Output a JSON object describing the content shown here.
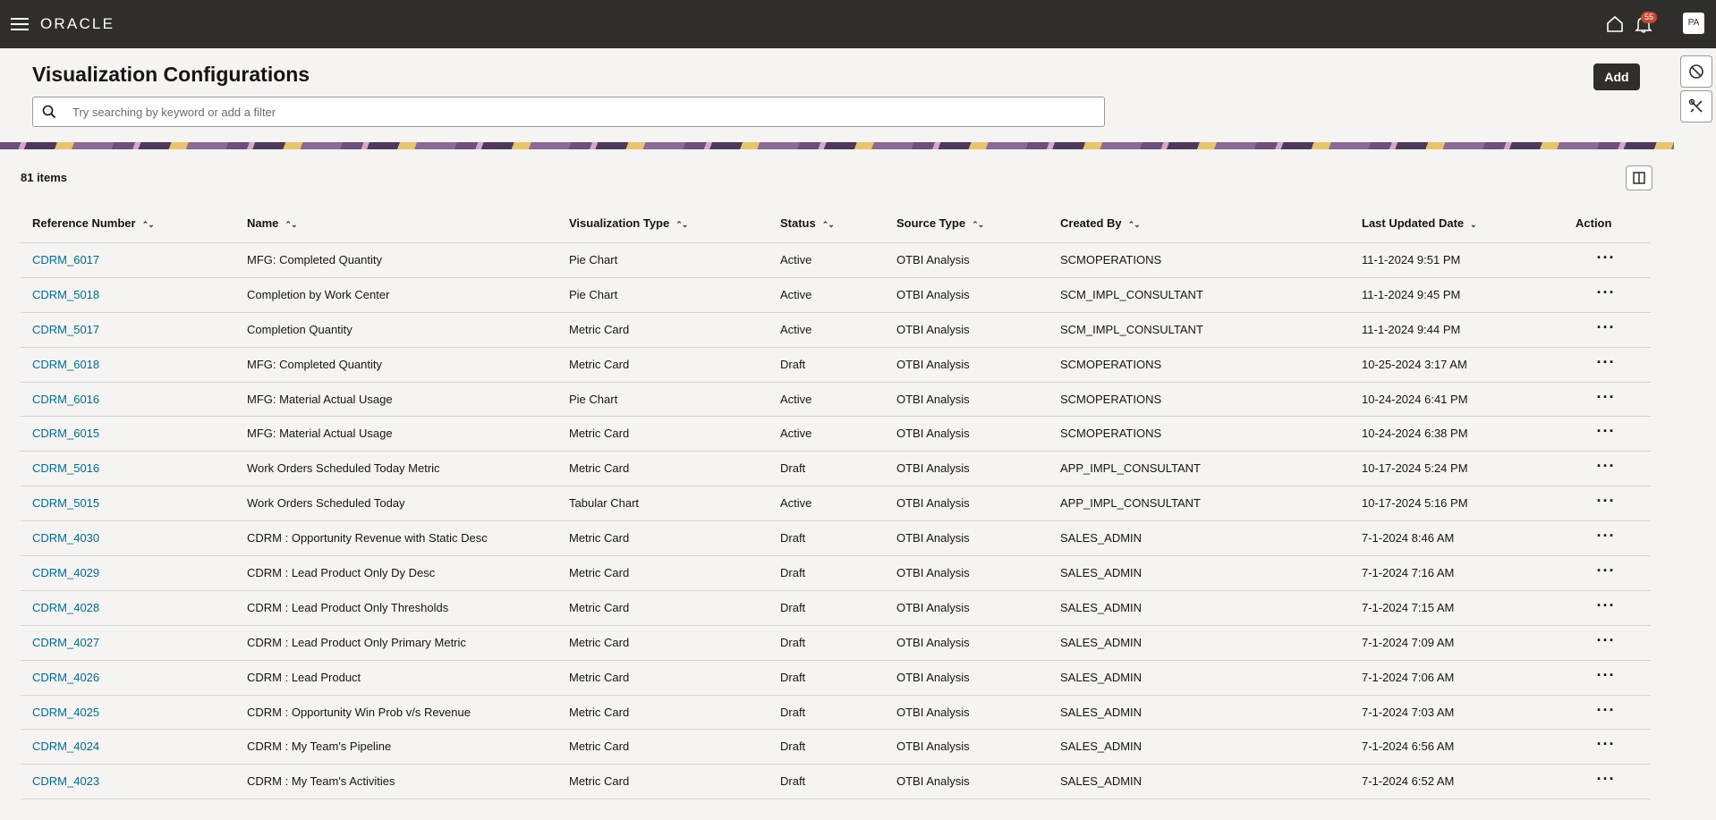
{
  "header": {
    "logo_text": "ORACLE",
    "notification_count": "55",
    "avatar_initials": "PA"
  },
  "page": {
    "title": "Visualization Configurations",
    "add_label": "Add",
    "search_placeholder": "Try searching by keyword or add a filter",
    "items_count": "81 items"
  },
  "table": {
    "columns": [
      {
        "label": "Reference Number",
        "sort": "both"
      },
      {
        "label": "Name",
        "sort": "both"
      },
      {
        "label": "Visualization Type",
        "sort": "both"
      },
      {
        "label": "Status",
        "sort": "both"
      },
      {
        "label": "Source Type",
        "sort": "both"
      },
      {
        "label": "Created By",
        "sort": "both"
      },
      {
        "label": "Last Updated Date",
        "sort": "descending"
      },
      {
        "label": "Action",
        "sort": "none"
      }
    ],
    "rows": [
      {
        "ref": "CDRM_6017",
        "name": "MFG: Completed Quantity",
        "type": "Pie Chart",
        "status": "Active",
        "source": "OTBI Analysis",
        "created_by": "SCMOPERATIONS",
        "updated": "11-1-2024 9:51 PM"
      },
      {
        "ref": "CDRM_5018",
        "name": "Completion by Work Center",
        "type": "Pie Chart",
        "status": "Active",
        "source": "OTBI Analysis",
        "created_by": "SCM_IMPL_CONSULTANT",
        "updated": "11-1-2024 9:45 PM"
      },
      {
        "ref": "CDRM_5017",
        "name": "Completion Quantity",
        "type": "Metric Card",
        "status": "Active",
        "source": "OTBI Analysis",
        "created_by": "SCM_IMPL_CONSULTANT",
        "updated": "11-1-2024 9:44 PM"
      },
      {
        "ref": "CDRM_6018",
        "name": "MFG: Completed Quantity",
        "type": "Metric Card",
        "status": "Draft",
        "source": "OTBI Analysis",
        "created_by": "SCMOPERATIONS",
        "updated": "10-25-2024 3:17 AM"
      },
      {
        "ref": "CDRM_6016",
        "name": "MFG: Material Actual Usage",
        "type": "Pie Chart",
        "status": "Active",
        "source": "OTBI Analysis",
        "created_by": "SCMOPERATIONS",
        "updated": "10-24-2024 6:41 PM"
      },
      {
        "ref": "CDRM_6015",
        "name": "MFG: Material Actual Usage",
        "type": "Metric Card",
        "status": "Active",
        "source": "OTBI Analysis",
        "created_by": "SCMOPERATIONS",
        "updated": "10-24-2024 6:38 PM"
      },
      {
        "ref": "CDRM_5016",
        "name": "Work Orders Scheduled Today Metric",
        "type": "Metric Card",
        "status": "Draft",
        "source": "OTBI Analysis",
        "created_by": "APP_IMPL_CONSULTANT",
        "updated": "10-17-2024 5:24 PM"
      },
      {
        "ref": "CDRM_5015",
        "name": "Work Orders Scheduled Today",
        "type": "Tabular Chart",
        "status": "Active",
        "source": "OTBI Analysis",
        "created_by": "APP_IMPL_CONSULTANT",
        "updated": "10-17-2024 5:16 PM"
      },
      {
        "ref": "CDRM_4030",
        "name": "CDRM : Opportunity Revenue with Static Desc",
        "type": "Metric Card",
        "status": "Draft",
        "source": "OTBI Analysis",
        "created_by": "SALES_ADMIN",
        "updated": "7-1-2024 8:46 AM"
      },
      {
        "ref": "CDRM_4029",
        "name": "CDRM : Lead Product Only Dy Desc",
        "type": "Metric Card",
        "status": "Draft",
        "source": "OTBI Analysis",
        "created_by": "SALES_ADMIN",
        "updated": "7-1-2024 7:16 AM"
      },
      {
        "ref": "CDRM_4028",
        "name": "CDRM : Lead Product Only Thresholds",
        "type": "Metric Card",
        "status": "Draft",
        "source": "OTBI Analysis",
        "created_by": "SALES_ADMIN",
        "updated": "7-1-2024 7:15 AM"
      },
      {
        "ref": "CDRM_4027",
        "name": "CDRM : Lead Product Only Primary Metric",
        "type": "Metric Card",
        "status": "Draft",
        "source": "OTBI Analysis",
        "created_by": "SALES_ADMIN",
        "updated": "7-1-2024 7:09 AM"
      },
      {
        "ref": "CDRM_4026",
        "name": "CDRM : Lead Product",
        "type": "Metric Card",
        "status": "Draft",
        "source": "OTBI Analysis",
        "created_by": "SALES_ADMIN",
        "updated": "7-1-2024 7:06 AM"
      },
      {
        "ref": "CDRM_4025",
        "name": "CDRM : Opportunity Win Prob v/s Revenue",
        "type": "Metric Card",
        "status": "Draft",
        "source": "OTBI Analysis",
        "created_by": "SALES_ADMIN",
        "updated": "7-1-2024 7:03 AM"
      },
      {
        "ref": "CDRM_4024",
        "name": "CDRM : My Team's Pipeline",
        "type": "Metric Card",
        "status": "Draft",
        "source": "OTBI Analysis",
        "created_by": "SALES_ADMIN",
        "updated": "7-1-2024 6:56 AM"
      },
      {
        "ref": "CDRM_4023",
        "name": "CDRM : My Team's Activities",
        "type": "Metric Card",
        "status": "Draft",
        "source": "OTBI Analysis",
        "created_by": "SALES_ADMIN",
        "updated": "7-1-2024 6:52 AM"
      }
    ]
  }
}
